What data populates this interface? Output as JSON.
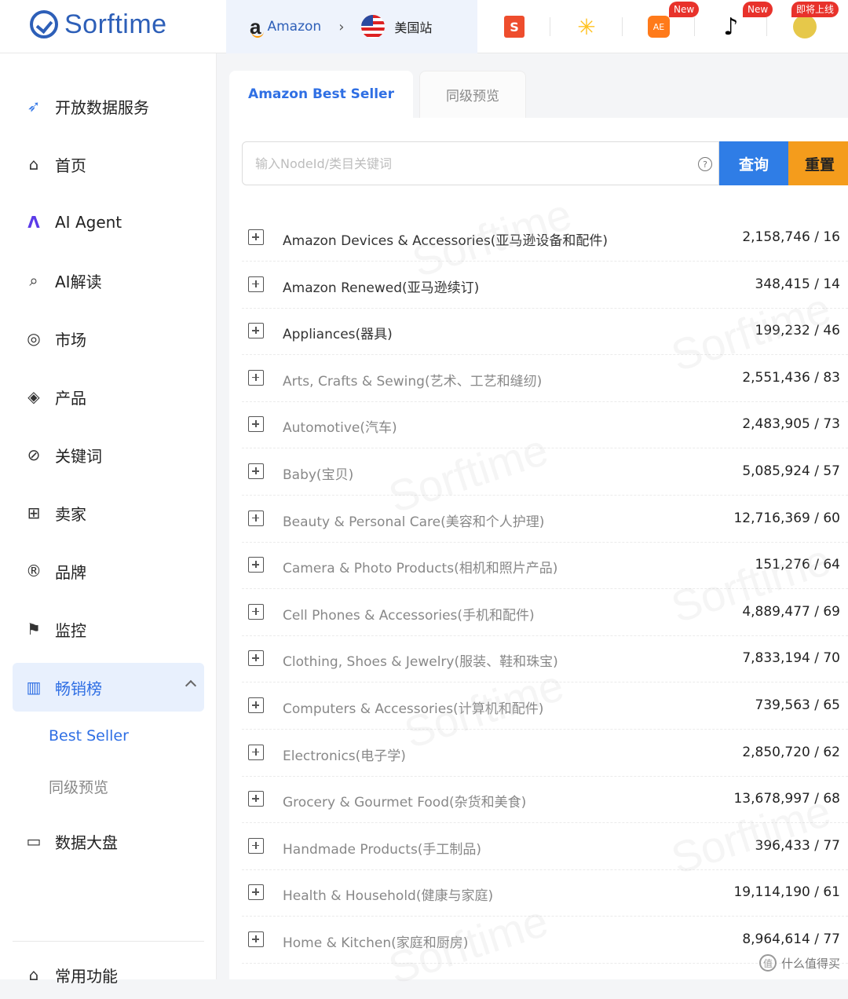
{
  "brand": {
    "name": "Sorftime"
  },
  "site_switch": {
    "marketplace": "Amazon",
    "country": "美国站"
  },
  "platforms": {
    "shopee_letter": "S",
    "aliexpress_text": "AE",
    "badge_new_1": "New",
    "badge_new_2": "New",
    "badge_soon": "即将上线"
  },
  "sidebar": {
    "items": [
      {
        "label": "开放数据服务",
        "icon": "open-data-icon"
      },
      {
        "label": "首页",
        "icon": "home-icon"
      },
      {
        "label": "AI Agent",
        "icon": "ai-agent-icon"
      },
      {
        "label": "AI解读",
        "icon": "ai-analysis-icon"
      },
      {
        "label": "市场",
        "icon": "market-icon"
      },
      {
        "label": "产品",
        "icon": "product-icon"
      },
      {
        "label": "关键词",
        "icon": "keyword-icon"
      },
      {
        "label": "卖家",
        "icon": "seller-icon"
      },
      {
        "label": "品牌",
        "icon": "brand-icon"
      },
      {
        "label": "监控",
        "icon": "monitor-icon"
      },
      {
        "label": "畅销榜",
        "icon": "bestseller-icon"
      },
      {
        "label": "数据大盘",
        "icon": "dashboard-icon"
      },
      {
        "label": "常用功能",
        "icon": "common-icon"
      }
    ],
    "sub_items": [
      "Best Seller",
      "同级预览"
    ]
  },
  "tabs": {
    "active": "Amazon Best Seller",
    "second": "同级预览"
  },
  "search": {
    "placeholder": "输入NodeId/类目关键词",
    "query_label": "查询",
    "reset_label": "重置"
  },
  "categories": [
    {
      "name": "Amazon Devices & Accessories(亚马逊设备和配件)",
      "count": "2,158,746 / 16"
    },
    {
      "name": "Amazon Renewed(亚马逊续订)",
      "count": "348,415 / 14"
    },
    {
      "name": "Appliances(器具)",
      "count": "199,232 / 46"
    },
    {
      "name": "Arts, Crafts & Sewing(艺术、工艺和缝纫)",
      "count": "2,551,436 / 83"
    },
    {
      "name": "Automotive(汽车)",
      "count": "2,483,905 / 73"
    },
    {
      "name": "Baby(宝贝)",
      "count": "5,085,924 / 57"
    },
    {
      "name": "Beauty & Personal Care(美容和个人护理)",
      "count": "12,716,369 / 60"
    },
    {
      "name": "Camera & Photo Products(相机和照片产品)",
      "count": "151,276 / 64"
    },
    {
      "name": "Cell Phones & Accessories(手机和配件)",
      "count": "4,889,477 / 69"
    },
    {
      "name": "Clothing, Shoes & Jewelry(服装、鞋和珠宝)",
      "count": "7,833,194 / 70"
    },
    {
      "name": "Computers & Accessories(计算机和配件)",
      "count": "739,563 / 65"
    },
    {
      "name": "Electronics(电子学)",
      "count": "2,850,720 / 62"
    },
    {
      "name": "Grocery & Gourmet Food(杂货和美食)",
      "count": "13,678,997 / 68"
    },
    {
      "name": "Handmade Products(手工制品)",
      "count": "396,433 / 77"
    },
    {
      "name": "Health & Household(健康与家庭)",
      "count": "19,114,190 / 61"
    },
    {
      "name": "Home & Kitchen(家庭和厨房)",
      "count": "8,964,614 / 77"
    }
  ],
  "watermark": "Sorftime",
  "credit": "什么值得买",
  "colors": {
    "brand": "#2d5fb8",
    "accent": "#2f6fe4",
    "query": "#2f7de6",
    "reset": "#f49c1c",
    "badge": "#e8322b"
  }
}
